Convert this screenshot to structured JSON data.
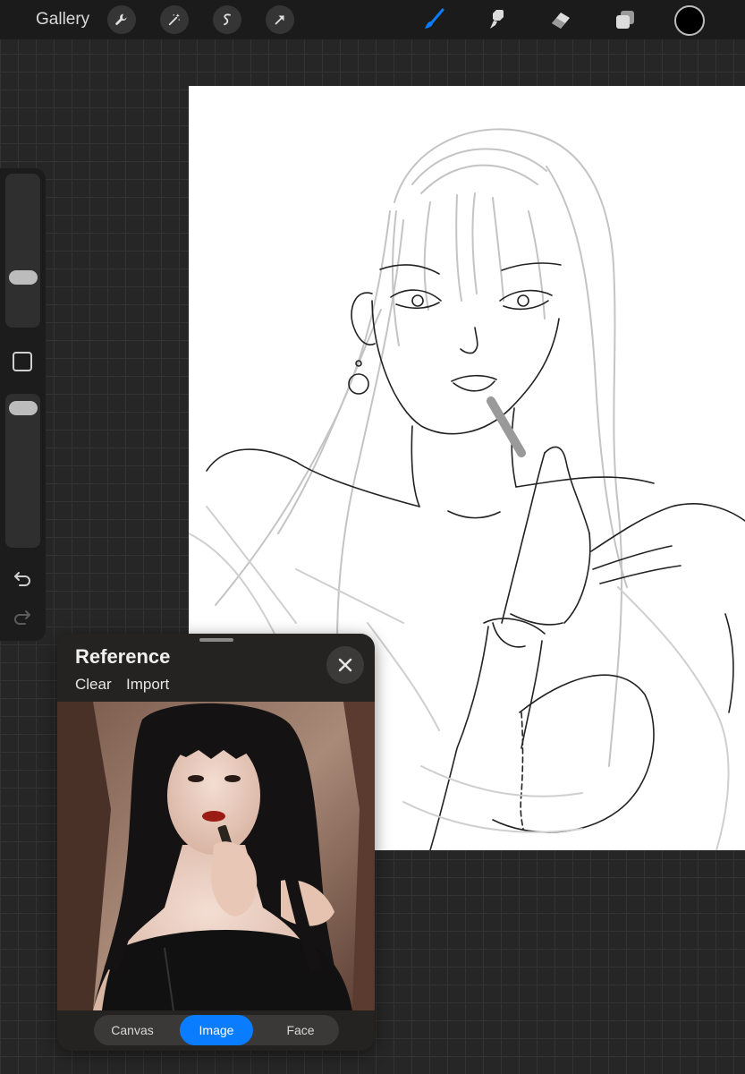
{
  "topbar": {
    "gallery_label": "Gallery",
    "left_tools": [
      "wrench-icon",
      "magic-wand-icon",
      "selection-icon",
      "transform-arrow-icon"
    ],
    "right_tools": [
      "brush-icon",
      "smudge-icon",
      "eraser-icon",
      "layers-icon"
    ],
    "active_tool": "brush-icon",
    "active_color": "#000000",
    "accent_color": "#0a7cff"
  },
  "sidebar": {
    "brush_size_level": 0.3,
    "opacity_level": 0.97,
    "icons": [
      "modify-square-icon",
      "undo-icon",
      "redo-icon"
    ]
  },
  "reference": {
    "title": "Reference",
    "clear_label": "Clear",
    "import_label": "Import",
    "tabs": [
      {
        "label": "Canvas",
        "active": false
      },
      {
        "label": "Image",
        "active": true
      },
      {
        "label": "Face",
        "active": false
      }
    ]
  }
}
